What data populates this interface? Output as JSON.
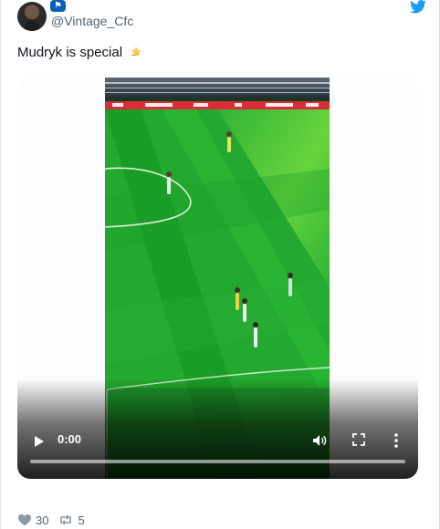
{
  "tweet": {
    "handle": "@Vintage_Cfc",
    "text": "Mudryk is special",
    "emoji": "dizzy-emoji"
  },
  "video": {
    "current_time": "0:00",
    "progress": 0
  },
  "actions": {
    "likes": "30",
    "retweets": "5"
  },
  "colors": {
    "twitter_blue": "#1d9bf0",
    "secondary_text": "#536471",
    "pitch_green": "#1f9c2a"
  },
  "icons": [
    "avatar",
    "chelsea-badge-icon",
    "twitter-bird-icon",
    "play-icon",
    "volume-icon",
    "fullscreen-icon",
    "more-options-icon",
    "heart-icon",
    "retweet-icon"
  ]
}
